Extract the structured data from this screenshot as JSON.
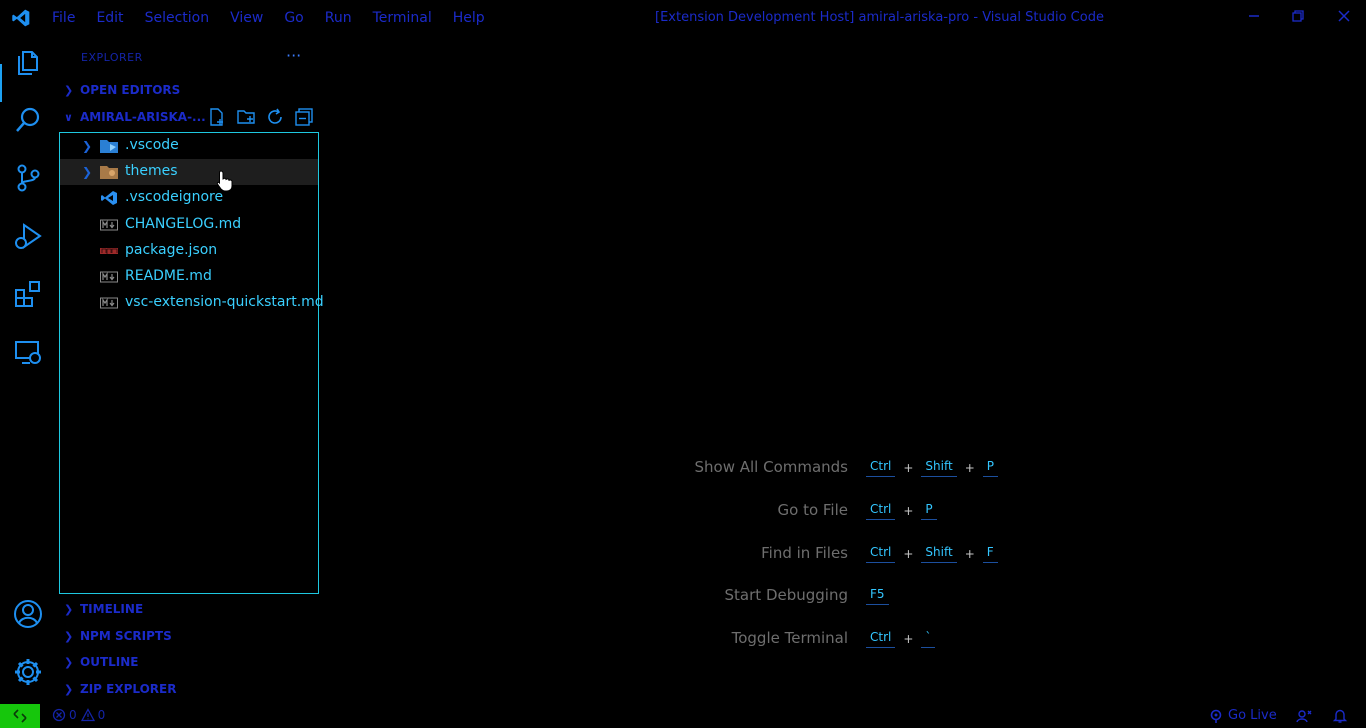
{
  "titlebar": {
    "menu": [
      "File",
      "Edit",
      "Selection",
      "View",
      "Go",
      "Run",
      "Terminal",
      "Help"
    ],
    "window_title": "[Extension Development Host] amiral-ariska-pro - Visual Studio Code"
  },
  "sidebar": {
    "title": "EXPLORER",
    "more_label": "···",
    "open_editors": "OPEN EDITORS",
    "folder": "AMIRAL-ARISKA-...",
    "files": [
      {
        "label": ".vscode",
        "type": "folder",
        "icon": "vscode-folder-icon"
      },
      {
        "label": "themes",
        "type": "folder",
        "icon": "themes-folder-icon"
      },
      {
        "label": ".vscodeignore",
        "type": "file",
        "icon": "vscode-file-icon"
      },
      {
        "label": "CHANGELOG.md",
        "type": "file",
        "icon": "markdown-icon"
      },
      {
        "label": "package.json",
        "type": "file",
        "icon": "npm-icon"
      },
      {
        "label": "README.md",
        "type": "file",
        "icon": "markdown-icon"
      },
      {
        "label": "vsc-extension-quickstart.md",
        "type": "file",
        "icon": "markdown-icon"
      }
    ],
    "bottom_sections": [
      "TIMELINE",
      "NPM SCRIPTS",
      "OUTLINE",
      "ZIP EXPLORER"
    ]
  },
  "editor": {
    "hints": [
      {
        "name": "Show All Commands",
        "keys": [
          "Ctrl",
          "Shift",
          "P"
        ]
      },
      {
        "name": "Go to File",
        "keys": [
          "Ctrl",
          "P"
        ]
      },
      {
        "name": "Find in Files",
        "keys": [
          "Ctrl",
          "Shift",
          "F"
        ]
      },
      {
        "name": "Start Debugging",
        "keys": [
          "F5"
        ]
      },
      {
        "name": "Toggle Terminal",
        "keys": [
          "Ctrl",
          "`"
        ]
      }
    ]
  },
  "statusbar": {
    "errors": "0",
    "warnings": "0",
    "go_live": "Go Live"
  },
  "colors": {
    "accent_blue": "#1b2bc9",
    "tree_text": "#3ad0ff",
    "tree_border": "#1ec8e0",
    "remote_green": "#16c60c",
    "hint_text": "#6e6e6e"
  }
}
